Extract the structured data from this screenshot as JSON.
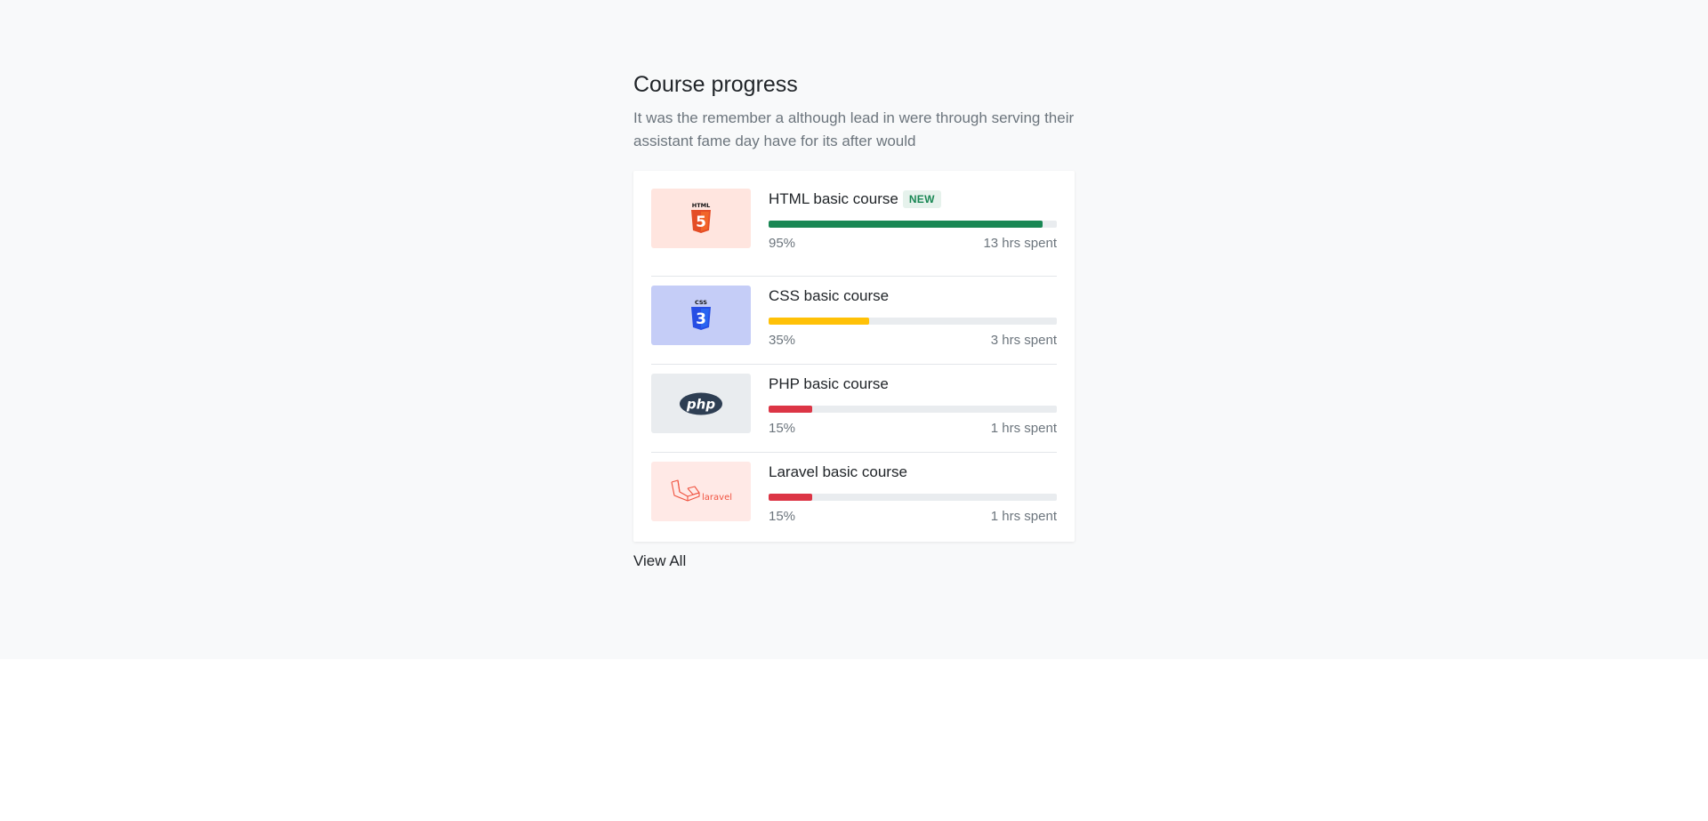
{
  "header": {
    "title": "Course progress",
    "subtitle": "It was the remember a although lead in were through serving their assistant fame day have for its after would"
  },
  "courses": [
    {
      "name": "HTML basic course",
      "badge": "NEW",
      "progress_percent": 95,
      "progress_label": "95%",
      "time_spent": "13 hrs spent",
      "icon": "html5-logo-icon",
      "thumb_bg": "#ffe5df",
      "bar_color": "#198754"
    },
    {
      "name": "CSS basic course",
      "badge": "",
      "progress_percent": 35,
      "progress_label": "35%",
      "time_spent": "3 hrs spent",
      "icon": "css3-logo-icon",
      "thumb_bg": "#c5cdf7",
      "bar_color": "#ffc107"
    },
    {
      "name": "PHP basic course",
      "badge": "",
      "progress_percent": 15,
      "progress_label": "15%",
      "time_spent": "1 hrs spent",
      "icon": "php-logo-icon",
      "thumb_bg": "#e9ecef",
      "bar_color": "#dc3545"
    },
    {
      "name": "Laravel basic course",
      "badge": "",
      "progress_percent": 15,
      "progress_label": "15%",
      "time_spent": "1 hrs spent",
      "icon": "laravel-logo-icon",
      "thumb_bg": "#ffe9e6",
      "bar_color": "#dc3545"
    }
  ],
  "logos": {
    "html_text": "HTML",
    "html_digit": "5",
    "css_text": "CSS",
    "css_digit": "3",
    "php_text": "php",
    "laravel_text": "laravel"
  },
  "footer": {
    "view_all": "View All"
  }
}
